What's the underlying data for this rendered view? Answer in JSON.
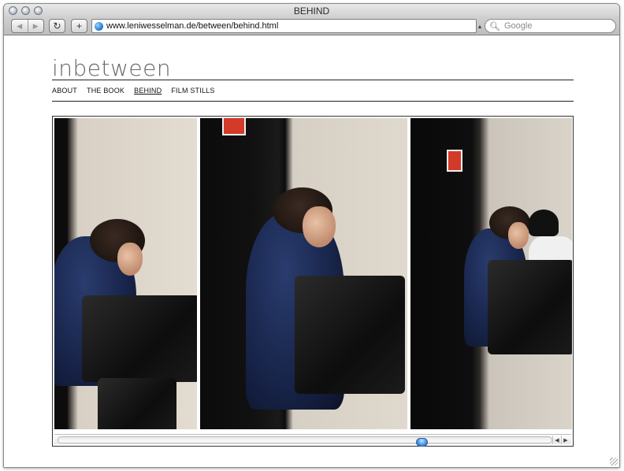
{
  "window": {
    "title": "BEHIND"
  },
  "toolbar": {
    "back_icon": "◀",
    "forward_icon": "▶",
    "reload_icon": "↻",
    "add_icon": "+",
    "url": "www.leniwesselman.de/between/behind.html",
    "search_placeholder": "Google"
  },
  "site": {
    "title": "inbetween",
    "nav": [
      {
        "label": "ABOUT",
        "active": false
      },
      {
        "label": "THE BOOK",
        "active": false
      },
      {
        "label": "BEHIND",
        "active": true
      },
      {
        "label": "FILM STILLS",
        "active": false
      }
    ]
  },
  "gallery": {
    "scroll_position": 0.74,
    "scroll_left_icon": "◀",
    "scroll_right_icon": "▶"
  },
  "colors": {
    "accent": "#4d96e6",
    "rule": "#222222"
  }
}
